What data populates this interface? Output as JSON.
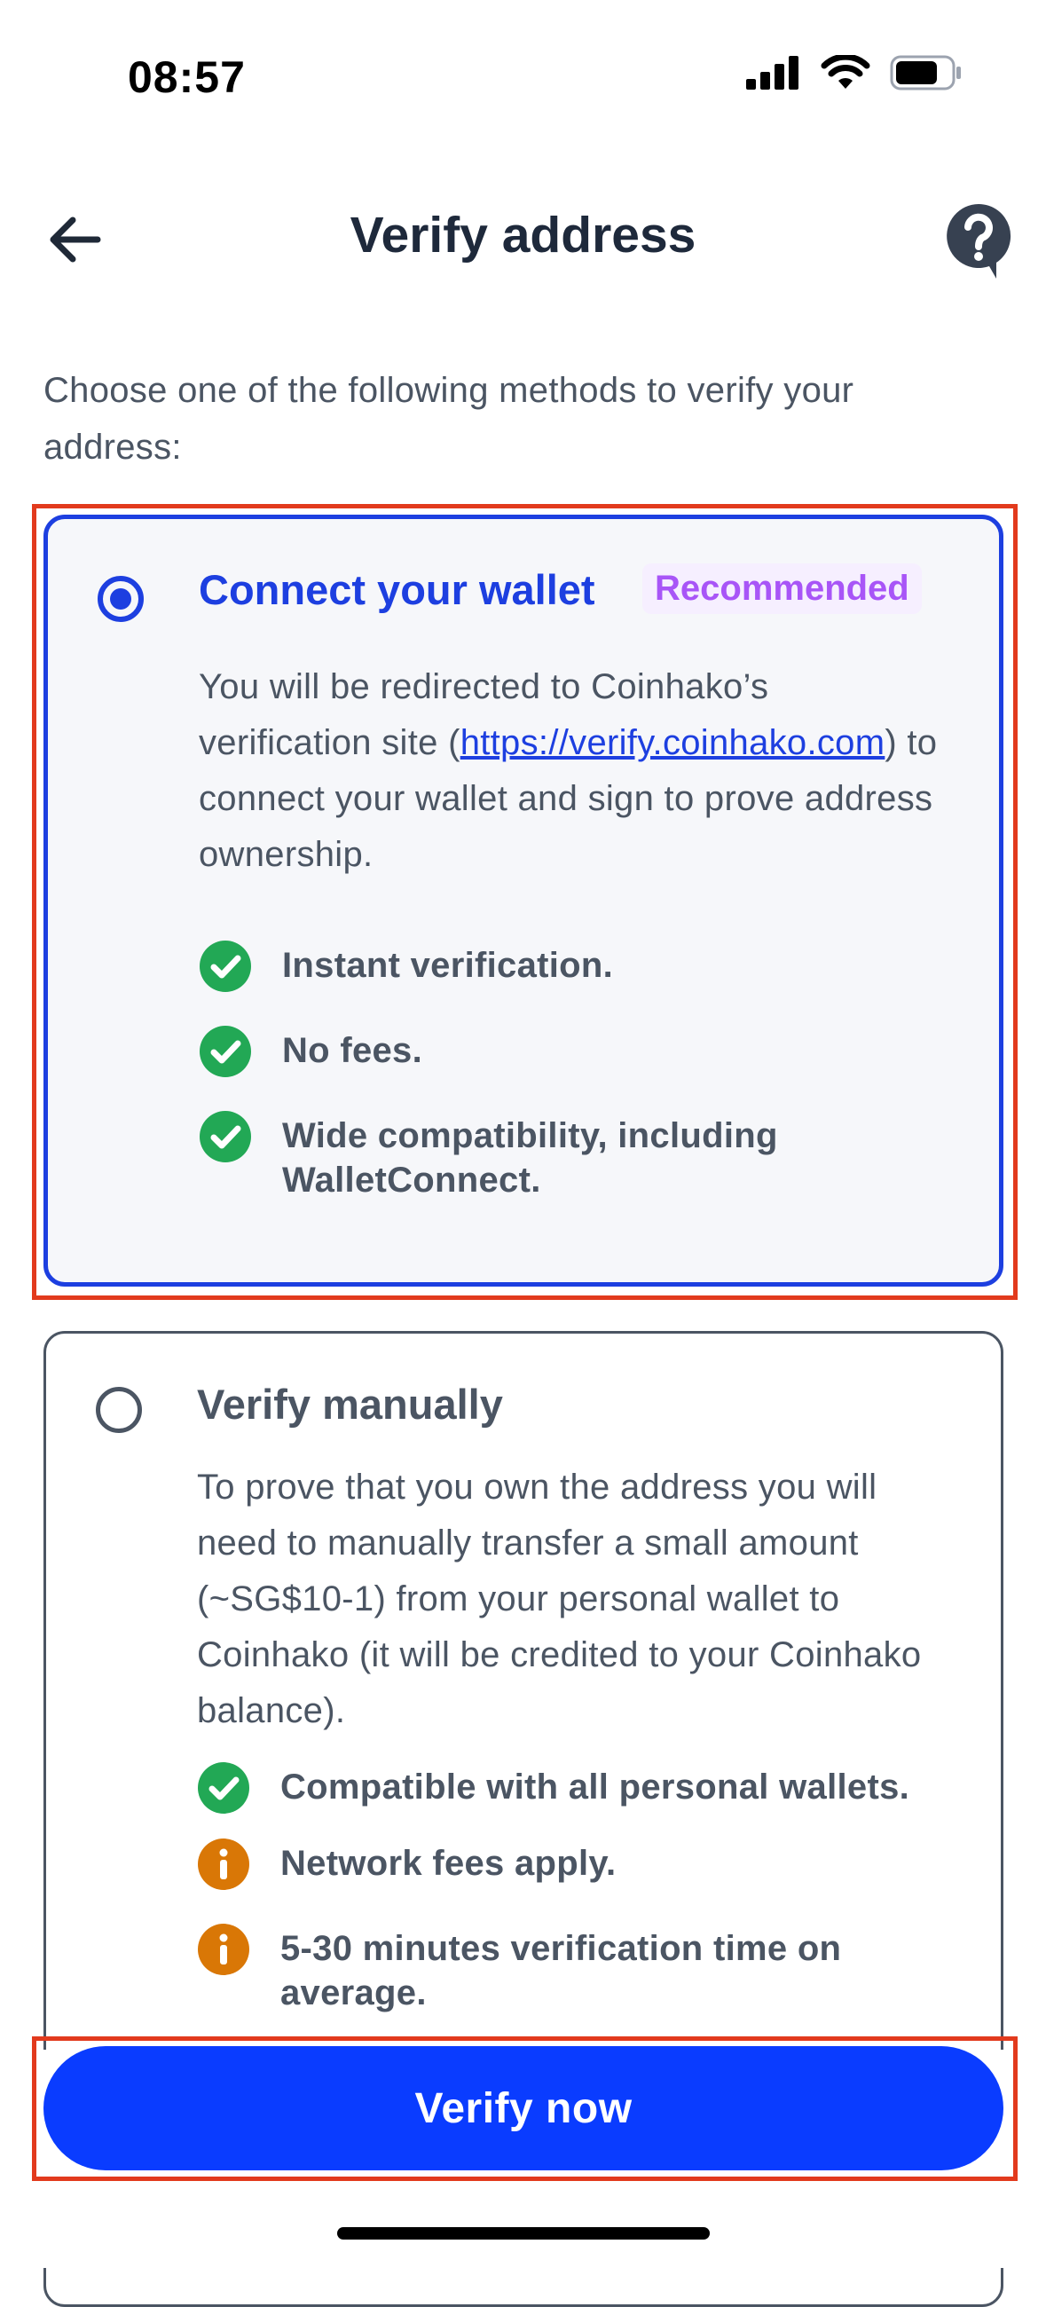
{
  "status_bar": {
    "time": "08:57"
  },
  "header": {
    "title": "Verify address"
  },
  "intro": "Choose one of the following methods to verify your address:",
  "options": [
    {
      "title": "Connect your wallet",
      "badge": "Recommended",
      "selected": true,
      "desc_before": "You will be redirected to Coinhako’s verification site (",
      "link": "https://verify.coinhako.com",
      "desc_after": ") to connect your wallet and sign to prove address ownership.",
      "features": [
        {
          "icon": "check-circle-icon",
          "text": "Instant verification."
        },
        {
          "icon": "check-circle-icon",
          "text": "No fees."
        },
        {
          "icon": "check-circle-icon",
          "text": "Wide compatibility, including WalletConnect."
        }
      ]
    },
    {
      "title": "Verify manually",
      "selected": false,
      "desc": "To prove that you own the address you will need to manually transfer a small amount (~SG$10-1) from your personal wallet to Coinhako (it will be credited to your Coinhako balance).",
      "features": [
        {
          "icon": "check-circle-icon",
          "text": "Compatible with all personal wallets."
        },
        {
          "icon": "info-circle-icon",
          "text": "Network fees apply."
        },
        {
          "icon": "info-circle-icon",
          "text": "5-30 minutes verification time on average."
        }
      ]
    }
  ],
  "cta": {
    "label": "Verify now"
  },
  "colors": {
    "primary": "#0a3cff",
    "success": "#22a855",
    "warning": "#d97706",
    "badge_text": "#a855f7",
    "annotation": "#e23a1d"
  }
}
